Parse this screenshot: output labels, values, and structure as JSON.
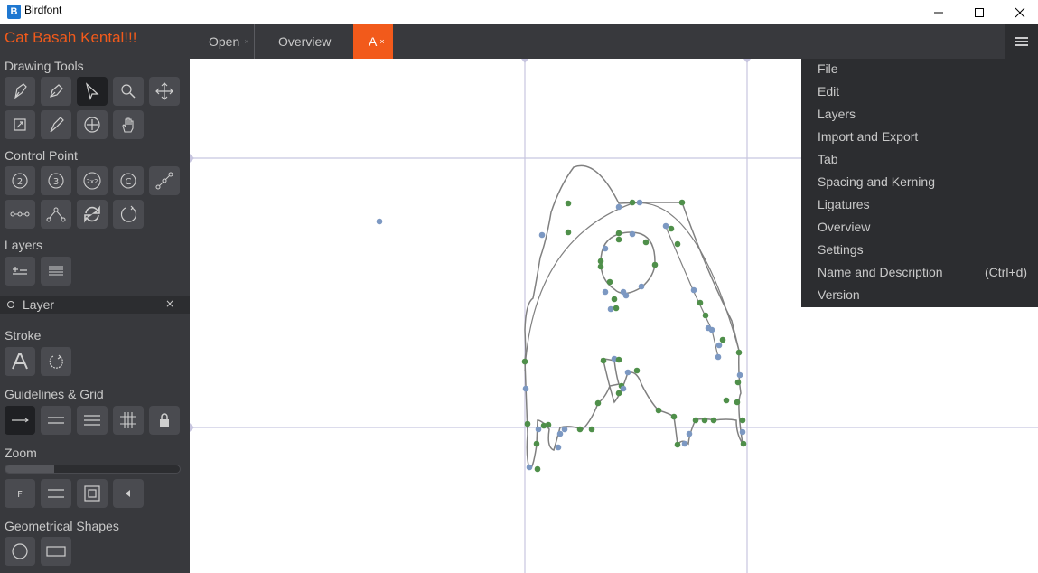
{
  "window": {
    "title": "Birdfont",
    "icon_letter": "B",
    "minimize_icon": "minimize-icon",
    "maximize_icon": "maximize-icon",
    "close_icon": "close-icon"
  },
  "sidebar": {
    "font_name": "Cat Basah Kental!!!",
    "sections": {
      "drawing_tools": "Drawing Tools",
      "control_point": "Control Point",
      "layers": "Layers",
      "stroke": "Stroke",
      "guidelines_grid": "Guidelines & Grid",
      "zoom": "Zoom",
      "geometrical_shapes": "Geometrical Shapes"
    },
    "control_point_labels": {
      "two": "2",
      "three": "3",
      "two_by_two": "2x2",
      "c": "C"
    },
    "layer": {
      "name": "Layer",
      "close": "×"
    },
    "zoom_button_label": "F",
    "zoom_level_fraction": 0.28
  },
  "tabs": [
    {
      "label": "Open",
      "close": "×"
    },
    {
      "label": "Overview",
      "close": "×"
    },
    {
      "label": "A",
      "close": "×",
      "active": true
    }
  ],
  "menu": {
    "items": [
      {
        "label": "File",
        "shortcut": ""
      },
      {
        "label": "Edit",
        "shortcut": ""
      },
      {
        "label": "Layers",
        "shortcut": ""
      },
      {
        "label": "Import and Export",
        "shortcut": ""
      },
      {
        "label": "Tab",
        "shortcut": ""
      },
      {
        "label": "Spacing and Kerning",
        "shortcut": ""
      },
      {
        "label": "Ligatures",
        "shortcut": ""
      },
      {
        "label": "Overview",
        "shortcut": ""
      },
      {
        "label": "Settings",
        "shortcut": ""
      },
      {
        "label": "Name and Description",
        "shortcut": "(Ctrl+d)"
      },
      {
        "label": "Version",
        "shortcut": ""
      }
    ]
  },
  "colors": {
    "accent": "#f25a1b",
    "sidebar_bg": "#38393d",
    "menu_bg": "#2c2d30",
    "guideline": "#c8c6e0",
    "point_green": "#4f8f4a",
    "point_blue": "#7c98c2",
    "path": "#808080"
  }
}
